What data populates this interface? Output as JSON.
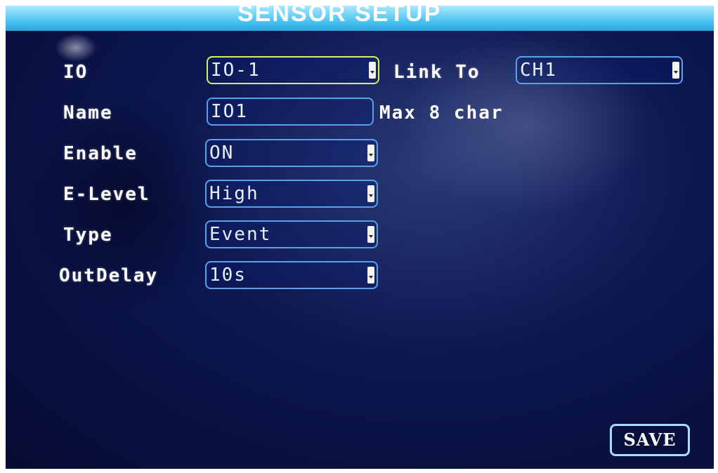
{
  "title": "SENSOR SETUP",
  "fields": {
    "io": {
      "label": "IO",
      "value": "IO-1"
    },
    "link_to": {
      "label": "Link To",
      "value": "CH1"
    },
    "name": {
      "label": "Name",
      "value": "IO1",
      "hint": "Max 8 char"
    },
    "enable": {
      "label": "Enable",
      "value": "ON"
    },
    "e_level": {
      "label": "E-Level",
      "value": "High"
    },
    "type": {
      "label": "Type",
      "value": "Event"
    },
    "out_delay": {
      "label": "OutDelay",
      "value": "10s"
    }
  },
  "save_label": "SAVE",
  "colors": {
    "title_bar": "#4fc4f0",
    "field_border": "#5aa2e8",
    "focus_border": "#d8f05a",
    "background": "#0c1650"
  }
}
